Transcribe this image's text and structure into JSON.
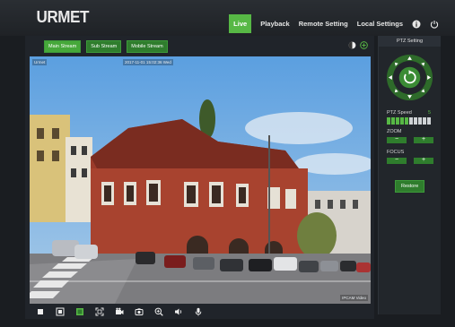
{
  "logo": "URMET",
  "nav": [
    {
      "label": "Live"
    },
    {
      "label": "Playback"
    },
    {
      "label": "Remote Setting"
    },
    {
      "label": "Local Settings"
    }
  ],
  "streams": [
    {
      "label": "Main Stream"
    },
    {
      "label": "Sub Stream"
    },
    {
      "label": "Mobile Stream"
    }
  ],
  "video": {
    "osd_name": "Urmet",
    "osd_time": "2017-11-01 15:02:36 Wed",
    "osd_bottom": "IPCAM Video"
  },
  "ptz": {
    "title": "PTZ Setting",
    "speed_label": "PTZ Speed",
    "speed_value": "5",
    "speed_level": 0.5,
    "zoom_label": "ZOOM",
    "focus_label": "FOCUS",
    "minus": "−",
    "plus": "+",
    "restore": "Restore"
  },
  "colors": {
    "accent": "#57b845",
    "panel": "#22262b",
    "background": "#1a1d21"
  }
}
